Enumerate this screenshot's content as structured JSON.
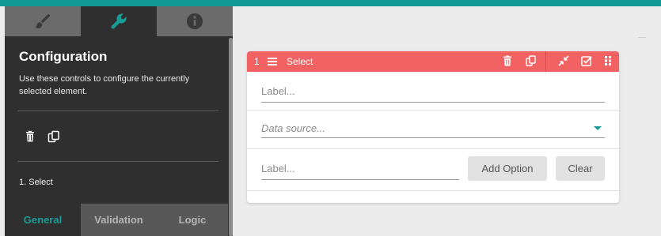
{
  "colors": {
    "accent": "#0f9a95",
    "panel_bg": "#2f2f2f",
    "header_red": "#f36262",
    "active_tab_text": "#1a9c96"
  },
  "left_panel": {
    "tabs": [
      {
        "name": "style",
        "icon": "brush-icon"
      },
      {
        "name": "configuration",
        "icon": "wrench-icon",
        "active": true
      },
      {
        "name": "info",
        "icon": "info-icon"
      }
    ],
    "title": "Configuration",
    "description": "Use these controls to configure the currently selected element.",
    "tools": [
      "trash-icon",
      "copy-icon"
    ],
    "breadcrumb": "1. Select",
    "bottom_tabs": [
      {
        "label": "General",
        "active": true
      },
      {
        "label": "Validation"
      },
      {
        "label": "Logic"
      }
    ]
  },
  "element": {
    "number": "1",
    "type": "Select",
    "header_icons": [
      "trash-icon",
      "copy-icon",
      "collapse-icon",
      "checkbox-icon",
      "drag-handle-icon"
    ],
    "label_placeholder": "Label...",
    "data_source_placeholder": "Data source...",
    "option_label_placeholder": "Label...",
    "add_option_label": "Add Option",
    "clear_label": "Clear"
  }
}
